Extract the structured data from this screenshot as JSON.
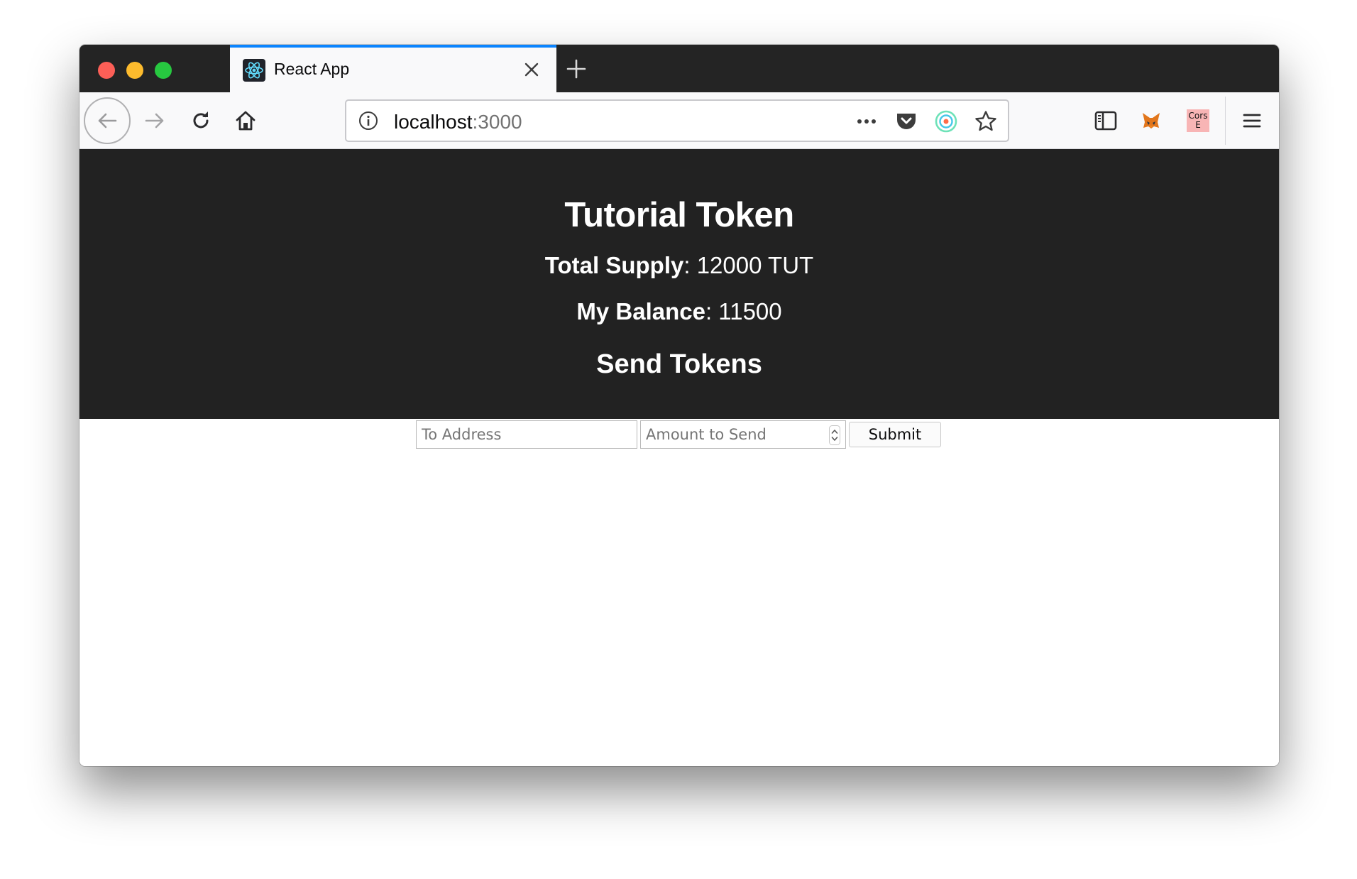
{
  "browser": {
    "tab": {
      "title": "React App",
      "favicon": "react-logo-icon"
    },
    "url": {
      "host": "localhost",
      "port": ":3000"
    },
    "toolbar": {
      "cors_label_line1": "Cors",
      "cors_label_line2": "E"
    },
    "colors": {
      "tab_accent": "#0a84ff",
      "tab_strip": "#242424",
      "react_blue": "#61dafb",
      "cors_badge": "#f8b5b5",
      "metamask_orange": "#e2761b"
    }
  },
  "app": {
    "title": "Tutorial Token",
    "total_supply_label": "Total Supply",
    "total_supply_value": ": 12000 TUT",
    "balance_label": "My Balance",
    "balance_value": ": 11500",
    "send_heading": "Send Tokens",
    "form": {
      "address_placeholder": "To Address",
      "amount_placeholder": "Amount to Send",
      "submit_label": "Submit"
    },
    "colors": {
      "header_background": "#222222",
      "header_text": "#ffffff"
    }
  }
}
